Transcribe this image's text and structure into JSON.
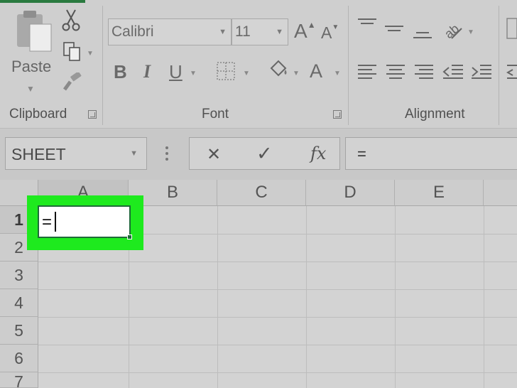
{
  "clipboard": {
    "paste_label": "Paste",
    "group_label": "Clipboard"
  },
  "font": {
    "name": "Calibri",
    "size": "11",
    "group_label": "Font",
    "bold": "B",
    "italic": "I",
    "underline": "U",
    "grow": "A",
    "shrink": "A",
    "font_color": "A"
  },
  "alignment": {
    "group_label": "Alignment"
  },
  "formula_bar": {
    "name_box": "SHEET",
    "cancel": "✕",
    "enter": "✓",
    "fx": "fx",
    "content": "="
  },
  "grid": {
    "columns": [
      "A",
      "B",
      "C",
      "D",
      "E"
    ],
    "rows": [
      "1",
      "2",
      "3",
      "4",
      "5",
      "6",
      "7"
    ],
    "active_cell_value": "="
  },
  "colors": {
    "highlight": "#1eea1e",
    "selection_border": "#1e6b38"
  }
}
